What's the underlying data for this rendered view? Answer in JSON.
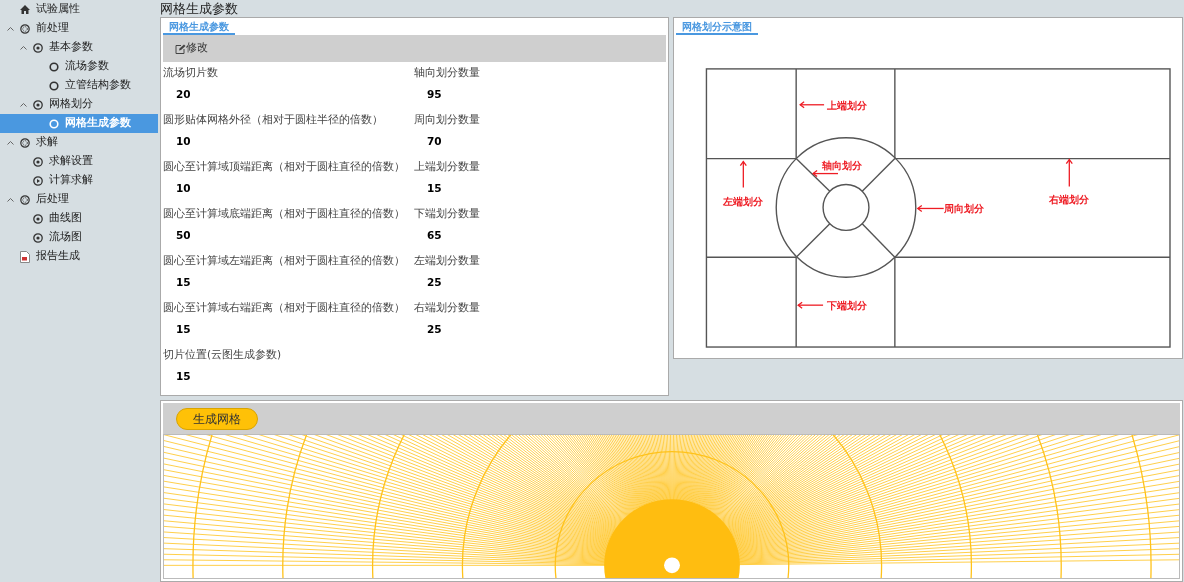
{
  "sidebar": {
    "items": [
      {
        "label": "试验属性",
        "kind": "home",
        "selected": false
      },
      {
        "label": "前处理",
        "kind": "group",
        "selected": false,
        "expanded": true,
        "children": [
          {
            "label": "基本参数",
            "kind": "section",
            "selected": false,
            "expanded": true,
            "children": [
              {
                "label": "流场参数",
                "kind": "leaf",
                "selected": false
              },
              {
                "label": "立管结构参数",
                "kind": "leaf",
                "selected": false
              }
            ]
          },
          {
            "label": "网格划分",
            "kind": "section",
            "selected": false,
            "expanded": true,
            "children": [
              {
                "label": "网格生成参数",
                "kind": "leaf",
                "selected": true
              }
            ]
          }
        ]
      },
      {
        "label": "求解",
        "kind": "group",
        "selected": false,
        "expanded": true,
        "children": [
          {
            "label": "求解设置",
            "kind": "section",
            "selected": false
          },
          {
            "label": "计算求解",
            "kind": "play",
            "selected": false
          }
        ]
      },
      {
        "label": "后处理",
        "kind": "group",
        "selected": false,
        "expanded": true,
        "children": [
          {
            "label": "曲线图",
            "kind": "section",
            "selected": false
          },
          {
            "label": "流场图",
            "kind": "section",
            "selected": false
          }
        ]
      },
      {
        "label": "报告生成",
        "kind": "report",
        "selected": false
      }
    ]
  },
  "page_title": "网格生成参数",
  "params_panel": {
    "tab": "网格生成参数",
    "edit_button": "修改",
    "fields": [
      {
        "label": "流场切片数",
        "value": "20"
      },
      {
        "label": "轴向划分数量",
        "value": "95"
      },
      {
        "label": "圆形贴体网格外径（相对于圆柱半径的倍数）",
        "value": "10"
      },
      {
        "label": "周向划分数量",
        "value": "70"
      },
      {
        "label": "圆心至计算域顶端距离（相对于圆柱直径的倍数）",
        "value": "10"
      },
      {
        "label": "上端划分数量",
        "value": "15"
      },
      {
        "label": "圆心至计算域底端距离（相对于圆柱直径的倍数）",
        "value": "50"
      },
      {
        "label": "下端划分数量",
        "value": "65"
      },
      {
        "label": "圆心至计算域左端距离（相对于圆柱直径的倍数）",
        "value": "15"
      },
      {
        "label": "左端划分数量",
        "value": "25"
      },
      {
        "label": "圆心至计算域右端距离（相对于圆柱直径的倍数）",
        "value": "15"
      },
      {
        "label": "右端划分数量",
        "value": "25"
      },
      {
        "label": "切片位置(云图生成参数)",
        "value": "15"
      }
    ]
  },
  "diagram_panel": {
    "tab": "网格划分示意图",
    "labels": {
      "top": "上端划分",
      "axial": "轴向划分",
      "left": "左端划分",
      "circumferential": "周向划分",
      "right": "右端划分",
      "bottom": "下端划分"
    }
  },
  "mesh_panel": {
    "generate_button": "生成网格"
  }
}
